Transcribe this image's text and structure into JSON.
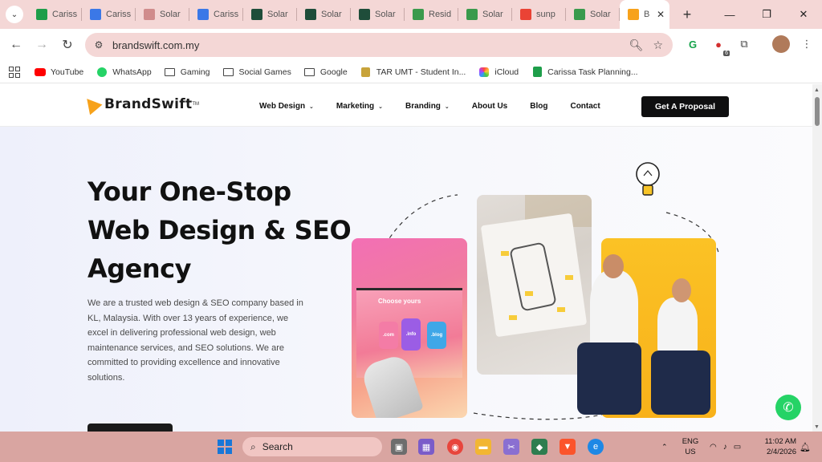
{
  "browser": {
    "tabs": [
      {
        "label": "Cariss",
        "icon": "sheets-icon",
        "color": "#1e9e4a"
      },
      {
        "label": "Cariss",
        "icon": "docs-icon",
        "color": "#3b78e7"
      },
      {
        "label": "Solar",
        "icon": "web-icon",
        "color": "#d08c8c"
      },
      {
        "label": "Cariss",
        "icon": "docs-icon",
        "color": "#3b78e7"
      },
      {
        "label": "Solar",
        "icon": "v-icon",
        "color": "#1f4d3a"
      },
      {
        "label": "Solar",
        "icon": "v-icon",
        "color": "#1f4d3a"
      },
      {
        "label": "Solar",
        "icon": "v-icon",
        "color": "#1f4d3a"
      },
      {
        "label": "Resid",
        "icon": "leaf-icon",
        "color": "#3a9a4c"
      },
      {
        "label": "Solar",
        "icon": "leaf-icon",
        "color": "#3a9a4c"
      },
      {
        "label": "sunp",
        "icon": "google-icon",
        "color": "#ea4335"
      },
      {
        "label": "Solar",
        "icon": "leaf-icon",
        "color": "#3a9a4c"
      }
    ],
    "active_tab": {
      "label": "B",
      "icon": "brandswift-icon",
      "color": "#f7a21b"
    },
    "url": "brandswift.com.my",
    "extension_badge": "6",
    "bookmarks": [
      {
        "label": "YouTube",
        "icon": "youtube-icon"
      },
      {
        "label": "WhatsApp",
        "icon": "whatsapp-icon"
      },
      {
        "label": "Gaming",
        "icon": "folder-icon"
      },
      {
        "label": "Social Games",
        "icon": "folder-icon"
      },
      {
        "label": "Google",
        "icon": "folder-icon"
      },
      {
        "label": "TAR UMT - Student In...",
        "icon": "crest-icon"
      },
      {
        "label": "iCloud",
        "icon": "icloud-icon"
      },
      {
        "label": "Carissa Task Planning...",
        "icon": "sheets-icon"
      }
    ]
  },
  "site": {
    "logo_text": "BrandSwift",
    "logo_tm": "TM",
    "nav": [
      {
        "label": "Web Design",
        "dropdown": true
      },
      {
        "label": "Marketing",
        "dropdown": true
      },
      {
        "label": "Branding",
        "dropdown": true
      },
      {
        "label": "About Us",
        "dropdown": false
      },
      {
        "label": "Blog",
        "dropdown": false
      },
      {
        "label": "Contact",
        "dropdown": false
      }
    ],
    "cta_label": "Get A Proposal",
    "hero": {
      "title_line1": "Your One-Stop",
      "title_line2": "Web Design & SEO",
      "title_line3": "Agency",
      "description": "We are a trusted web design & SEO company based in KL, Malaysia. With over 13 years of experience, we excel in delivering professional web design, web maintenance services, and SEO solutions. We are committed to providing excellence and innovative solutions."
    },
    "mockup": {
      "choose_text": "Choose yours",
      "domains": [
        ".com",
        ".info",
        ".blog"
      ]
    },
    "colors": {
      "accent": "#f7a21b",
      "cta": "#0f0f10",
      "whatsapp": "#25d366"
    }
  },
  "taskbar": {
    "search_label": "Search",
    "lang_line1": "ENG",
    "lang_line2": "US",
    "time": "11:02 AM",
    "date": "2/4/2026"
  }
}
